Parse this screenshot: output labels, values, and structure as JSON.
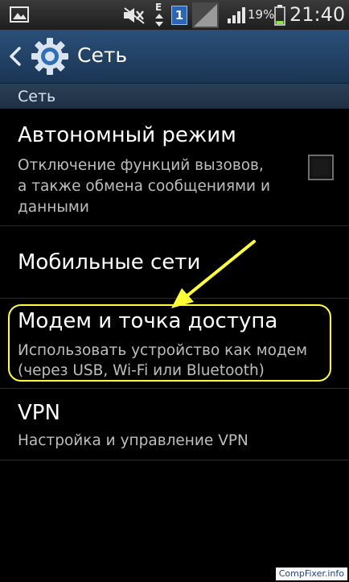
{
  "status_bar": {
    "network_type": "E",
    "sim_slot": "1",
    "battery_percent": "19%",
    "time": "21:40",
    "icons": [
      "gallery-icon",
      "mute-icon",
      "sim-icon",
      "signal-icon",
      "battery-icon"
    ]
  },
  "action_bar": {
    "title": "Сеть",
    "icons": [
      "back-icon",
      "settings-gear-icon"
    ],
    "accent_color": "#2b4f78"
  },
  "section": {
    "header": "Сеть"
  },
  "settings": {
    "airplane": {
      "title": "Автономный режим",
      "summary_lines": [
        "Отключение функций вызовов,",
        "а также обмена сообщениями и",
        "данными"
      ],
      "checked": false
    },
    "mobile": {
      "title": "Мобильные сети"
    },
    "tethering": {
      "title": "Модем и точка доступа",
      "summary_lines": [
        "Использовать устройство как модем",
        "(через USB, Wi-Fi или Bluetooth)"
      ]
    },
    "vpn": {
      "title": "VPN",
      "summary_lines": [
        "Настройка и управление VPN"
      ]
    }
  },
  "annotation": {
    "highlight_color": "#ffff33"
  },
  "watermark": {
    "text": "CompFixer.info"
  }
}
